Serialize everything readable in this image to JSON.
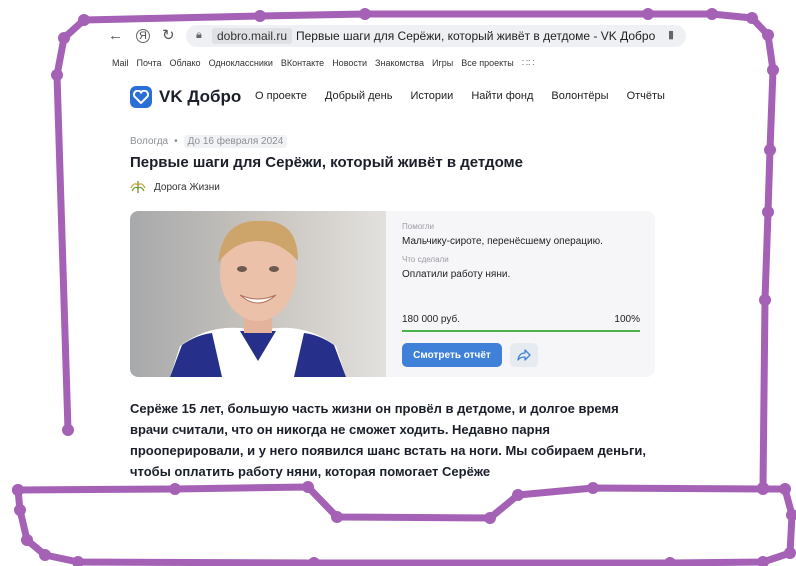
{
  "browser": {
    "back_icon": "←",
    "yandex_icon": "Я",
    "reload_icon": "↻",
    "domain": "dobro.mail.ru",
    "tab_title": "Первые шаги для Серёжи, который живёт в детдоме - VK Добро"
  },
  "bookmarks": [
    "Mail",
    "Почта",
    "Облако",
    "Одноклассники",
    "ВКонтакте",
    "Новости",
    "Знакомства",
    "Игры",
    "Все проекты"
  ],
  "site": {
    "logo_text": "VK Добро",
    "nav": [
      "О проекте",
      "Добрый день",
      "Истории",
      "Найти фонд",
      "Волонтёры",
      "Отчёты"
    ]
  },
  "article": {
    "city": "Вологда",
    "date": "До 16 февраля 2024",
    "title": "Первые шаги для Серёжи, который живёт в детдоме",
    "org": "Дорога Жизни"
  },
  "card": {
    "helped_label": "Помогли",
    "helped_text": "Мальчику-сироте, перенёсшему операцию.",
    "done_label": "Что сделали",
    "done_text": "Оплатили работу няни.",
    "amount": "180 000 руб.",
    "percent": "100%",
    "progress": 1.0,
    "report_button": "Смотреть отчёт",
    "accent": "#3f80d8",
    "progress_color": "#4bb34b"
  },
  "story": "Серёже 15 лет, большую часть жизни он провёл в детдоме, и долгое время врачи считали, что он никогда не сможет ходить. Недавно парня прооперировали, и у него появился шанс встать на ноги. Мы собираем деньги, чтобы оплатить работу няни, которая помогает Серёже",
  "overlay_color": "#a461b5"
}
